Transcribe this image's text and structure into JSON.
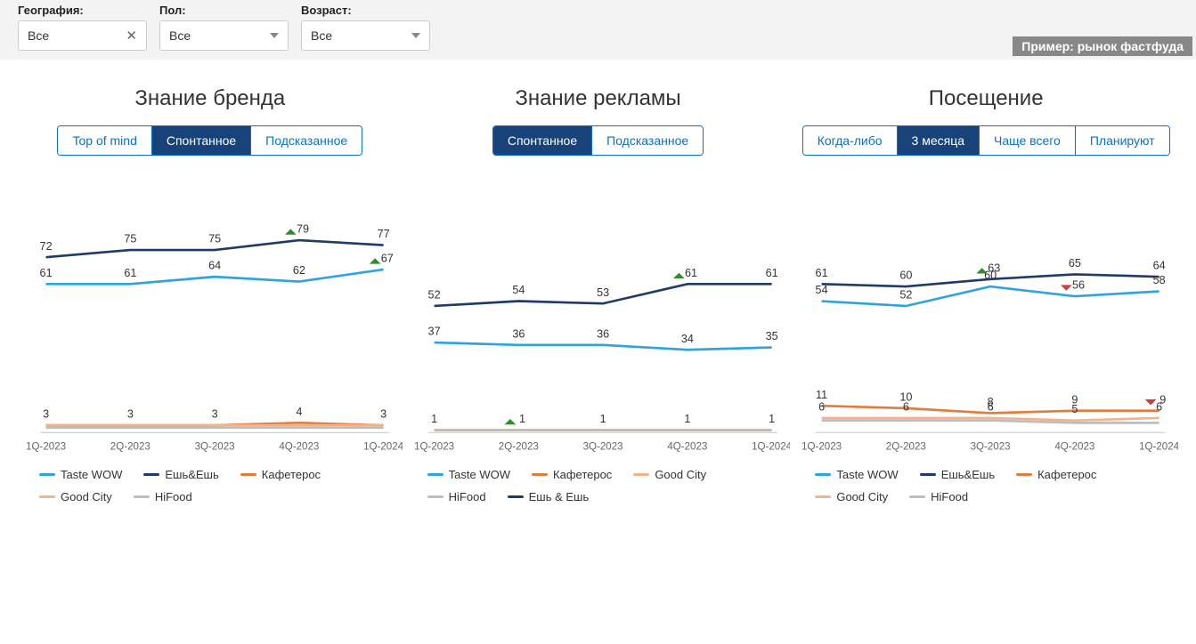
{
  "filters": {
    "geography": {
      "label": "География:",
      "value": "Все"
    },
    "gender": {
      "label": "Пол:",
      "value": "Все"
    },
    "age": {
      "label": "Возраст:",
      "value": "Все"
    }
  },
  "example_tag": "Пример: рынок фастфуда",
  "x_categories": [
    "1Q-2023",
    "2Q-2023",
    "3Q-2023",
    "4Q-2023",
    "1Q-2024"
  ],
  "panels": [
    {
      "title": "Знание бренда",
      "tabs": [
        "Top of mind",
        "Спонтанное",
        "Подсказанное"
      ],
      "active_tab": 1,
      "legend": [
        {
          "name": "Taste WOW",
          "color": "#2fa3dd"
        },
        {
          "name": "Ешь&Ешь",
          "color": "#1f3b66"
        },
        {
          "name": "Кафетерос",
          "color": "#e47a3c"
        },
        {
          "name": "Good City",
          "color": "#f0b48a"
        },
        {
          "name": "HiFood",
          "color": "#bdbdbd"
        }
      ]
    },
    {
      "title": "Знание рекламы",
      "tabs": [
        "Спонтанное",
        "Подсказанное"
      ],
      "active_tab": 0,
      "legend": [
        {
          "name": "Taste WOW",
          "color": "#2fa3dd"
        },
        {
          "name": "Кафетерос",
          "color": "#e47a3c"
        },
        {
          "name": "Good City",
          "color": "#f0b48a"
        },
        {
          "name": "HiFood",
          "color": "#bdbdbd"
        },
        {
          "name": "Ешь & Ешь",
          "color": "#1f3b66"
        }
      ]
    },
    {
      "title": "Посещение",
      "tabs": [
        "Когда-либо",
        "3 месяца",
        "Чаще всего",
        "Планируют"
      ],
      "active_tab": 1,
      "legend": [
        {
          "name": "Taste WOW",
          "color": "#2fa3dd"
        },
        {
          "name": "Ешь&Ешь",
          "color": "#1f3b66"
        },
        {
          "name": "Кафетерос",
          "color": "#e47a3c"
        },
        {
          "name": "Good City",
          "color": "#f0b48a"
        },
        {
          "name": "HiFood",
          "color": "#bdbdbd"
        }
      ]
    }
  ],
  "chart_data": [
    {
      "type": "line",
      "title": "Знание бренда — Спонтанное",
      "categories": [
        "1Q-2023",
        "2Q-2023",
        "3Q-2023",
        "4Q-2023",
        "1Q-2024"
      ],
      "ylim": [
        0,
        100
      ],
      "series": [
        {
          "name": "Ешь&Ешь",
          "color": "#1f3b66",
          "values": [
            72,
            75,
            75,
            79,
            77
          ],
          "markers": [
            null,
            null,
            null,
            "up",
            null
          ]
        },
        {
          "name": "Taste WOW",
          "color": "#2fa3dd",
          "values": [
            61,
            61,
            64,
            62,
            67
          ],
          "markers": [
            null,
            null,
            null,
            null,
            "up"
          ]
        },
        {
          "name": "Кафетерос",
          "color": "#e47a3c",
          "values": [
            3,
            3,
            3,
            4,
            3
          ],
          "markers": [
            null,
            null,
            null,
            null,
            null
          ]
        },
        {
          "name": "Good City",
          "color": "#f0b48a",
          "values": [
            3,
            3,
            3,
            3,
            3
          ],
          "labels": false
        },
        {
          "name": "HiFood",
          "color": "#bdbdbd",
          "values": [
            2,
            2,
            2,
            2,
            2
          ],
          "labels": false
        }
      ]
    },
    {
      "type": "line",
      "title": "Знание рекламы — Спонтанное",
      "categories": [
        "1Q-2023",
        "2Q-2023",
        "3Q-2023",
        "4Q-2023",
        "1Q-2024"
      ],
      "ylim": [
        0,
        100
      ],
      "series": [
        {
          "name": "Ешь & Ешь",
          "color": "#1f3b66",
          "values": [
            52,
            54,
            53,
            61,
            61
          ],
          "markers": [
            null,
            null,
            null,
            "up",
            null
          ]
        },
        {
          "name": "Taste WOW",
          "color": "#2fa3dd",
          "values": [
            37,
            36,
            36,
            34,
            35
          ],
          "markers": [
            null,
            null,
            null,
            null,
            null
          ]
        },
        {
          "name": "Кафетерос",
          "color": "#e47a3c",
          "values": [
            1,
            1,
            1,
            1,
            1
          ],
          "markers": [
            null,
            "up",
            null,
            null,
            null
          ]
        },
        {
          "name": "Good City",
          "color": "#f0b48a",
          "values": [
            1,
            1,
            1,
            1,
            1
          ],
          "labels": false
        },
        {
          "name": "HiFood",
          "color": "#bdbdbd",
          "values": [
            1,
            1,
            1,
            1,
            1
          ],
          "labels": false
        }
      ]
    },
    {
      "type": "line",
      "title": "Посещение — 3 месяца",
      "categories": [
        "1Q-2023",
        "2Q-2023",
        "3Q-2023",
        "4Q-2023",
        "1Q-2024"
      ],
      "ylim": [
        0,
        100
      ],
      "series": [
        {
          "name": "Ешь&Ешь",
          "color": "#1f3b66",
          "values": [
            61,
            60,
            63,
            65,
            64
          ],
          "markers": [
            null,
            null,
            "up",
            null,
            null
          ]
        },
        {
          "name": "Taste WOW",
          "color": "#2fa3dd",
          "values": [
            54,
            52,
            60,
            56,
            58
          ],
          "markers": [
            null,
            null,
            null,
            "down",
            null
          ]
        },
        {
          "name": "Кафетерос",
          "color": "#e47a3c",
          "values": [
            11,
            10,
            8,
            9,
            9
          ],
          "markers": [
            null,
            null,
            null,
            null,
            "down"
          ]
        },
        {
          "name": "Good City",
          "color": "#f0b48a",
          "values": [
            6,
            6,
            6,
            5,
            6
          ],
          "markers": [
            null,
            null,
            null,
            null,
            null
          ]
        },
        {
          "name": "HiFood",
          "color": "#bdbdbd",
          "values": [
            5,
            5,
            5,
            4,
            4
          ],
          "labels": false
        }
      ]
    }
  ]
}
